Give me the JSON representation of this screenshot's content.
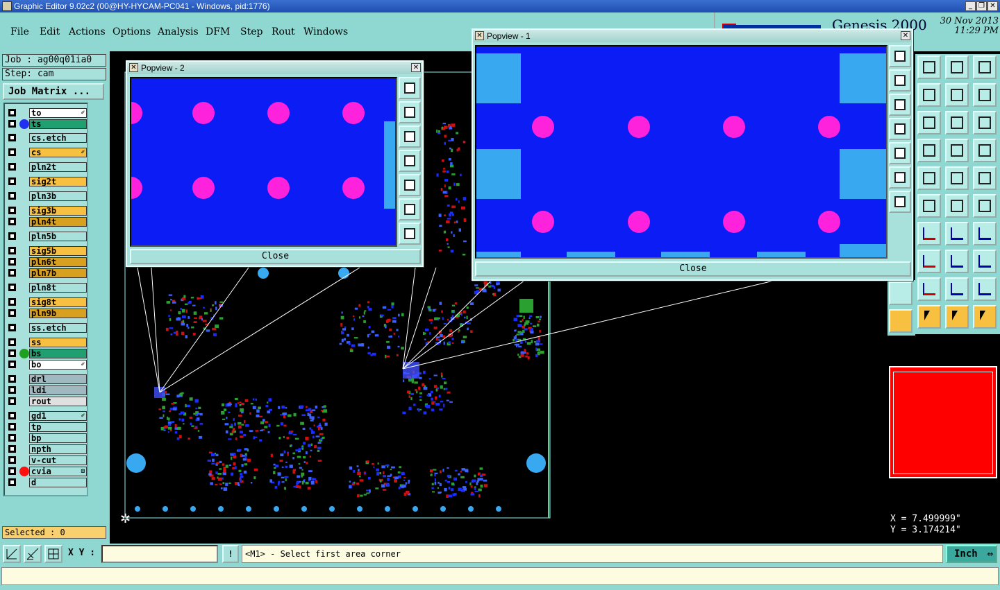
{
  "window": {
    "title": "Graphic Editor 9.02c2 (00@HY-HYCAM-PC041 - Windows, pid:1776)"
  },
  "menu": [
    "File",
    "Edit",
    "Actions",
    "Options",
    "Analysis",
    "DFM",
    "Step",
    "Rout",
    "Windows"
  ],
  "brand": {
    "product": "Genesis 2000",
    "date": "30 Nov 2013",
    "time": "11:29 PM"
  },
  "job": {
    "job_label": "Job : ag00q01ia0",
    "step_label": "Step: cam",
    "matrix_button": "Job Matrix ..."
  },
  "layers": [
    {
      "name": "to",
      "color": "#ffffff",
      "dot": "",
      "mark": "✐"
    },
    {
      "name": "ts",
      "color": "#20a070",
      "dot": "#2030f0",
      "mark": ""
    },
    {
      "name": "cs.etch",
      "color": "#a8e0dc",
      "dot": "",
      "mark": ""
    },
    {
      "name": "cs",
      "color": "#f8c040",
      "dot": "",
      "mark": "✐"
    },
    {
      "name": "pln2t",
      "color": "#a8e0dc",
      "dot": "",
      "mark": ""
    },
    {
      "name": "sig2t",
      "color": "#f8c040",
      "dot": "",
      "mark": ""
    },
    {
      "name": "pln3b",
      "color": "#a8e0dc",
      "dot": "",
      "mark": ""
    },
    {
      "name": "sig3b",
      "color": "#f8c040",
      "dot": "",
      "mark": ""
    },
    {
      "name": "pln4t",
      "color": "#d8a020",
      "dot": "",
      "mark": ""
    },
    {
      "name": "pln5b",
      "color": "#a8e0dc",
      "dot": "",
      "mark": ""
    },
    {
      "name": "sig5b",
      "color": "#f8c040",
      "dot": "",
      "mark": ""
    },
    {
      "name": "pln6t",
      "color": "#d8a020",
      "dot": "",
      "mark": ""
    },
    {
      "name": "pln7b",
      "color": "#d8a020",
      "dot": "",
      "mark": ""
    },
    {
      "name": "pln8t",
      "color": "#a8e0dc",
      "dot": "",
      "mark": ""
    },
    {
      "name": "sig8t",
      "color": "#f8c040",
      "dot": "",
      "mark": ""
    },
    {
      "name": "pln9b",
      "color": "#d8a020",
      "dot": "",
      "mark": ""
    },
    {
      "name": "ss.etch",
      "color": "#a8e0dc",
      "dot": "",
      "mark": ""
    },
    {
      "name": "ss",
      "color": "#f8c040",
      "dot": "",
      "mark": ""
    },
    {
      "name": "bs",
      "color": "#20a070",
      "dot": "#20a020",
      "mark": ""
    },
    {
      "name": "bo",
      "color": "#ffffff",
      "dot": "",
      "mark": "✐"
    },
    {
      "name": "drl",
      "color": "#a0b8c0",
      "dot": "",
      "mark": ""
    },
    {
      "name": "ldi",
      "color": "#a0b8c0",
      "dot": "",
      "mark": ""
    },
    {
      "name": "rout",
      "color": "#e0e0e0",
      "dot": "",
      "mark": ""
    },
    {
      "name": "gd1",
      "color": "#a8e0dc",
      "dot": "",
      "mark": "✐"
    },
    {
      "name": "tp",
      "color": "#a8e0dc",
      "dot": "",
      "mark": ""
    },
    {
      "name": "bp",
      "color": "#a8e0dc",
      "dot": "",
      "mark": ""
    },
    {
      "name": "npth",
      "color": "#a8e0dc",
      "dot": "",
      "mark": ""
    },
    {
      "name": "v-cut",
      "color": "#a8e0dc",
      "dot": "",
      "mark": ""
    },
    {
      "name": "cvia",
      "color": "#a8e0dc",
      "dot": "#ff1010",
      "mark": "⊞"
    },
    {
      "name": "d",
      "color": "#a8e0dc",
      "dot": "",
      "mark": ""
    }
  ],
  "selected": "Selected : 0",
  "popview2": {
    "title": "Popview - 2",
    "close": "Close"
  },
  "popview1": {
    "title": "Popview - 1",
    "close": "Close"
  },
  "coords": {
    "x": "X =  7.499999\"",
    "y": "Y =  3.174214\""
  },
  "bottom": {
    "xy_label": "X Y :",
    "xy_value": "",
    "warn": "!",
    "prompt": "<M1> - Select first area corner",
    "units": "Inch"
  },
  "colors": {
    "pad": "#ff22dd",
    "copper": "#0b1cf5",
    "light": "#38a8f0",
    "panel": "#8fd8d2"
  }
}
